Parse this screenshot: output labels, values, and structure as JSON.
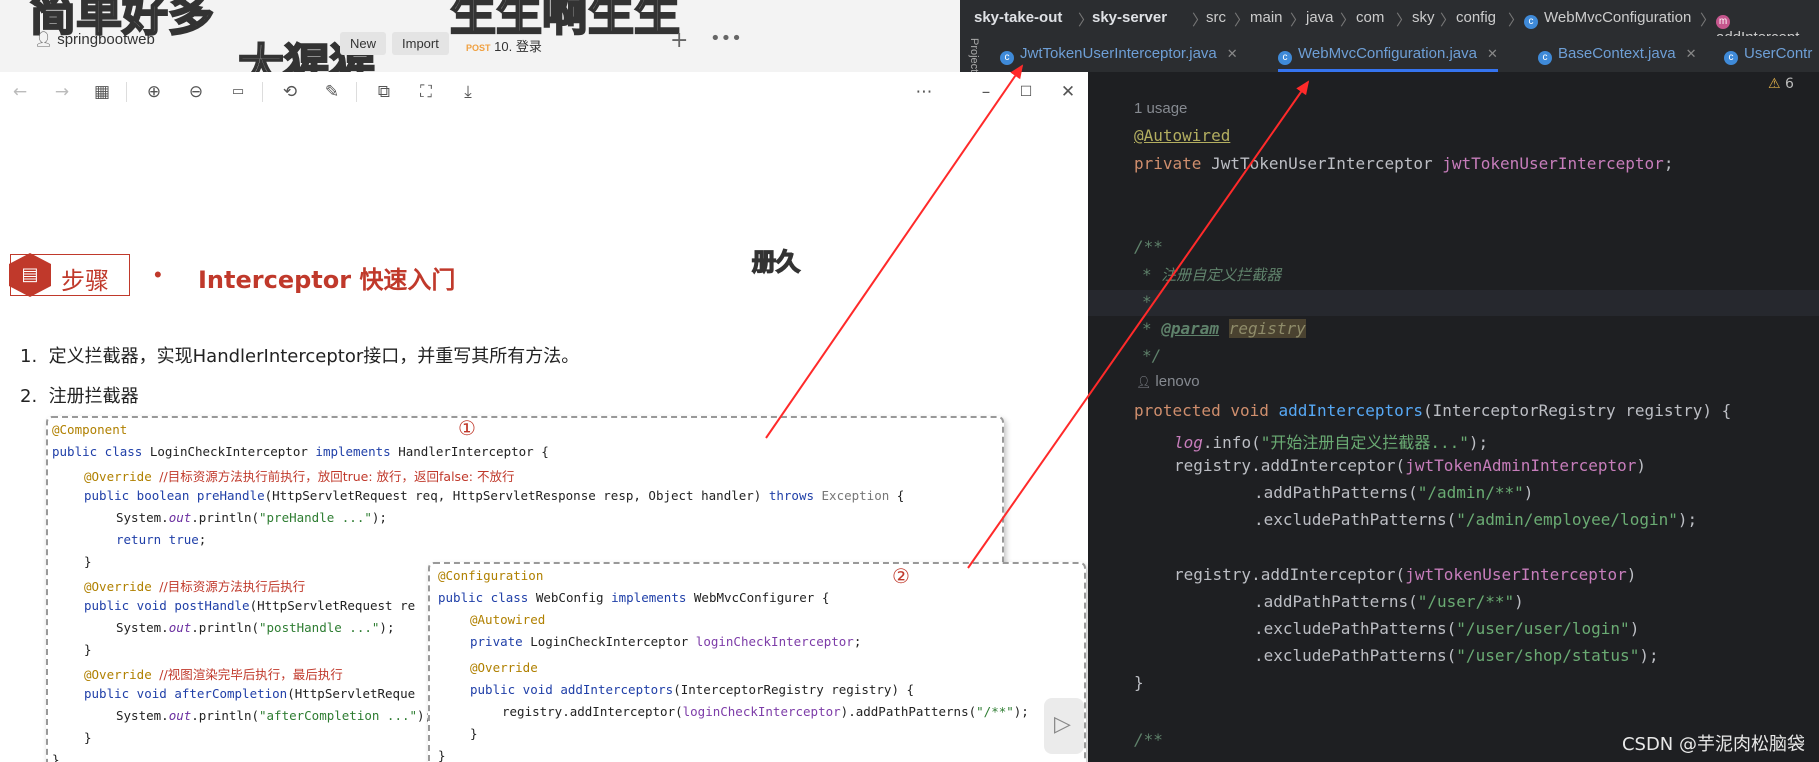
{
  "background_page": {
    "overlay_text_1": "简单好多",
    "overlay_text_2": "生生啊生生",
    "overlay_text_3": "大猩猩",
    "overlay_text_4": "册久",
    "workspace_name": "springbootweb",
    "new_button": "New",
    "import_button": "Import",
    "request_method": "POST",
    "request_name": "10. 登录"
  },
  "slide": {
    "step_label": "步骤",
    "title_bullet": "•",
    "title": "Interceptor 快速入门",
    "list": [
      {
        "num": "1.",
        "text": "定义拦截器，实现HandlerInterceptor接口，并重写其所有方法。"
      },
      {
        "num": "2.",
        "text": "注册拦截器"
      }
    ],
    "box1_marker": "①",
    "box2_marker": "②"
  },
  "ide": {
    "breadcrumb": [
      "sky-take-out",
      "sky-server",
      "src",
      "main",
      "java",
      "com",
      "sky",
      "config",
      "WebMvcConfiguration",
      "addIntercept"
    ],
    "tabs": [
      {
        "label": "JwtTokenUserInterceptor.java"
      },
      {
        "label": "WebMvcConfiguration.java"
      },
      {
        "label": "BaseContext.java"
      },
      {
        "label": "UserContr"
      }
    ],
    "sidebar_label": "Project",
    "warning_count": "6",
    "usage_hint": "1 usage",
    "author_hint": "lenovo"
  },
  "watermark": "CSDN @芋泥肉松脑袋",
  "colors": {
    "accent_red": "#c0392b",
    "arrow_red": "#ff2a2a",
    "ide_bg": "#1e1f22"
  }
}
